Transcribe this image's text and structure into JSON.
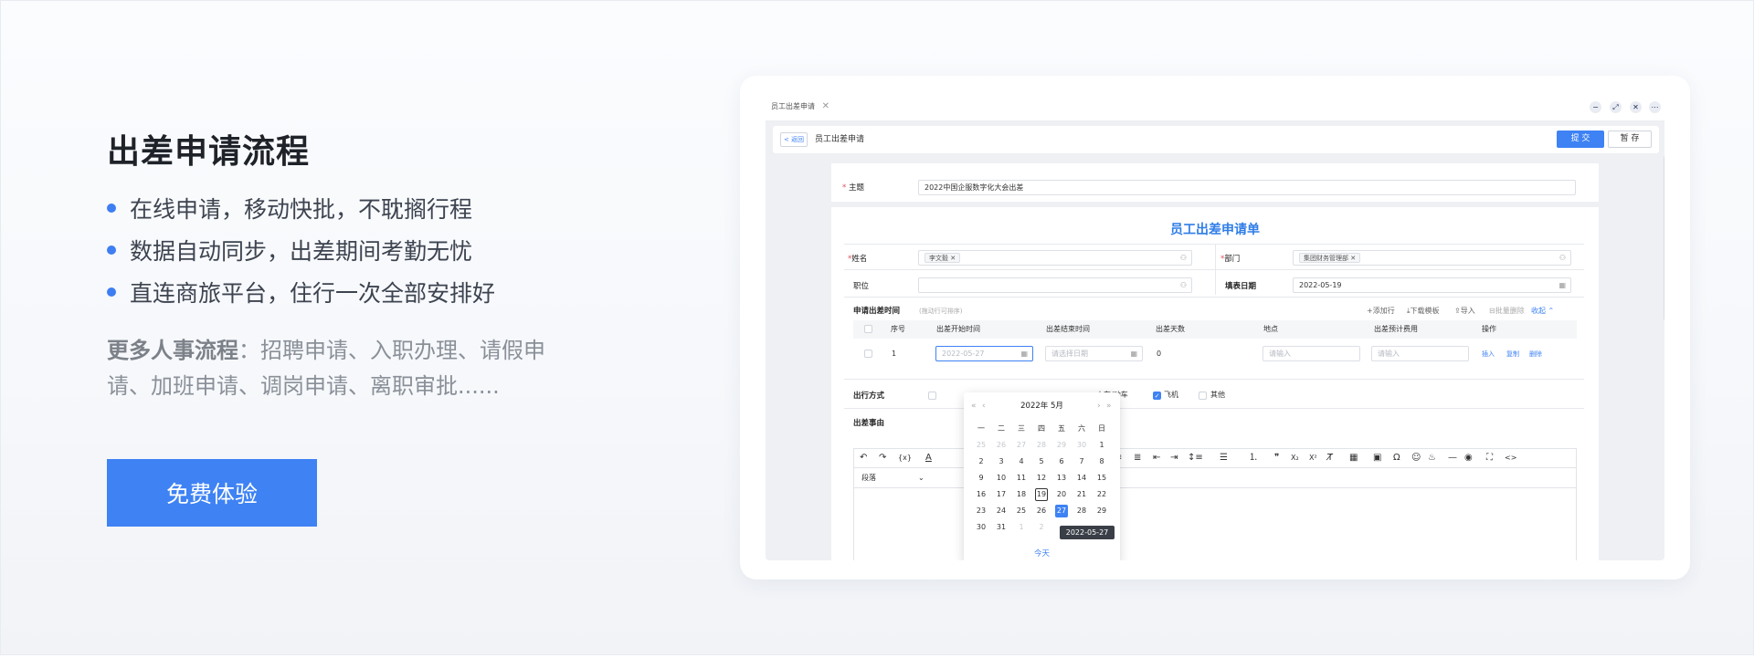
{
  "hero": {
    "title": "出差申请流程",
    "bullets": [
      "在线申请，移动快批，不耽搁行程",
      "数据自动同步，出差期间考勤无忧",
      "直连商旅平台，住行一次全部安排好"
    ],
    "more_label": "更多人事流程",
    "more_text": "：招聘申请、入职办理、请假申请、加班申请、调岗申请、离职审批......",
    "cta": "免费体验"
  },
  "colors": {
    "accent": "#3e82f4",
    "title_blue": "#2f7de8",
    "required": "#e34d59"
  },
  "window": {
    "tab": "员工出差申请",
    "tab_close": "✕",
    "controls": [
      "minimize-icon",
      "expand-icon",
      "close-icon",
      "more-icon"
    ],
    "back": "< 返回",
    "title": "员工出差申请",
    "submit": "提 交",
    "save": "暂 存"
  },
  "form": {
    "subject_label": "主题",
    "subject_value": "2022中国企服数字化大会出差",
    "form_title": "员工出差申请单",
    "name_label": "姓名",
    "name_value": "李文毅",
    "dept_label": "部门",
    "dept_value": "集团财务管理部",
    "position_label": "职位",
    "date_label": "填表日期",
    "date_value": "2022-05-19",
    "period_label": "申请出差时间",
    "period_hint": "(拖动行可排序)",
    "actions": [
      "添加行",
      "下载模板",
      "导入",
      "批量删除",
      "收起"
    ],
    "columns": [
      "序号",
      "出差开始时间",
      "出差结束时间",
      "出差天数",
      "地点",
      "出差预计费用",
      "操作"
    ],
    "row": {
      "index": "1",
      "start": "2022-05-27",
      "end_placeholder": "请选择日期",
      "days": "0",
      "place_placeholder": "请输入",
      "cost_placeholder": "请输入",
      "row_actions": [
        "插入",
        "复制",
        "删除"
      ]
    },
    "travel_label": "出行方式",
    "travel_options": [
      {
        "label": "火车/动车",
        "checked": false
      },
      {
        "label": "飞机",
        "checked": true
      },
      {
        "label": "其他",
        "checked": false
      }
    ],
    "reason_label": "出差事由",
    "paragraph_select": "段落"
  },
  "datepicker": {
    "year_month": "2022年  5月",
    "weekdays": [
      "一",
      "二",
      "三",
      "四",
      "五",
      "六",
      "日"
    ],
    "days": [
      [
        "25",
        "26",
        "27",
        "28",
        "29",
        "30",
        "1"
      ],
      [
        "2",
        "3",
        "4",
        "5",
        "6",
        "7",
        "8"
      ],
      [
        "9",
        "10",
        "11",
        "12",
        "13",
        "14",
        "15"
      ],
      [
        "16",
        "17",
        "18",
        "19",
        "20",
        "21",
        "22"
      ],
      [
        "23",
        "24",
        "25",
        "26",
        "27",
        "28",
        "29"
      ],
      [
        "30",
        "31",
        "1",
        "2",
        "",
        "",
        ""
      ]
    ],
    "tooltip": "2022-05-27",
    "today": "今天"
  }
}
